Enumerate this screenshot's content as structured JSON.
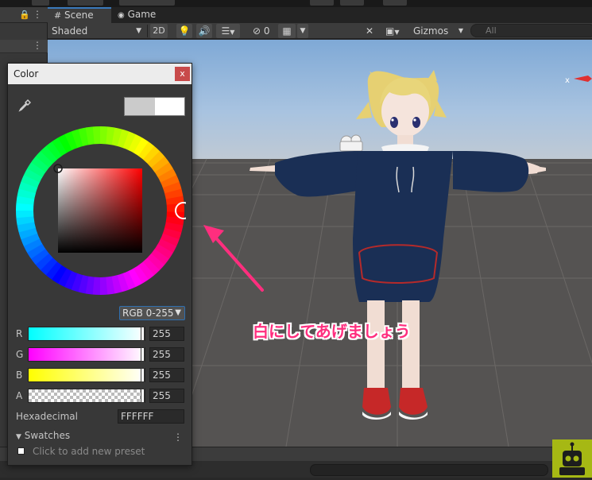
{
  "scene_tabs": {
    "scene": "Scene",
    "game": "Game"
  },
  "toolbar": {
    "shading_mode": "Shaded",
    "mode_2d": "2D",
    "hidden_count": "0",
    "gizmos": "Gizmos",
    "search_placeholder": "All"
  },
  "color_window": {
    "title": "Color",
    "close": "x",
    "mode": "RGB 0-255",
    "channels": [
      {
        "label": "R",
        "value": "255"
      },
      {
        "label": "G",
        "value": "255"
      },
      {
        "label": "B",
        "value": "255"
      },
      {
        "label": "A",
        "value": "255"
      }
    ],
    "hex_label": "Hexadecimal",
    "hex_value": "FFFFFF",
    "swatches_label": "Swatches",
    "preset_hint": "Click to add new preset"
  },
  "annotation": "白にしてあげましょう",
  "axis_label": "x",
  "colors": {
    "annotation": "#ff2e7e",
    "accent_blue": "#3a79bb",
    "close_red": "#c84a4a"
  }
}
